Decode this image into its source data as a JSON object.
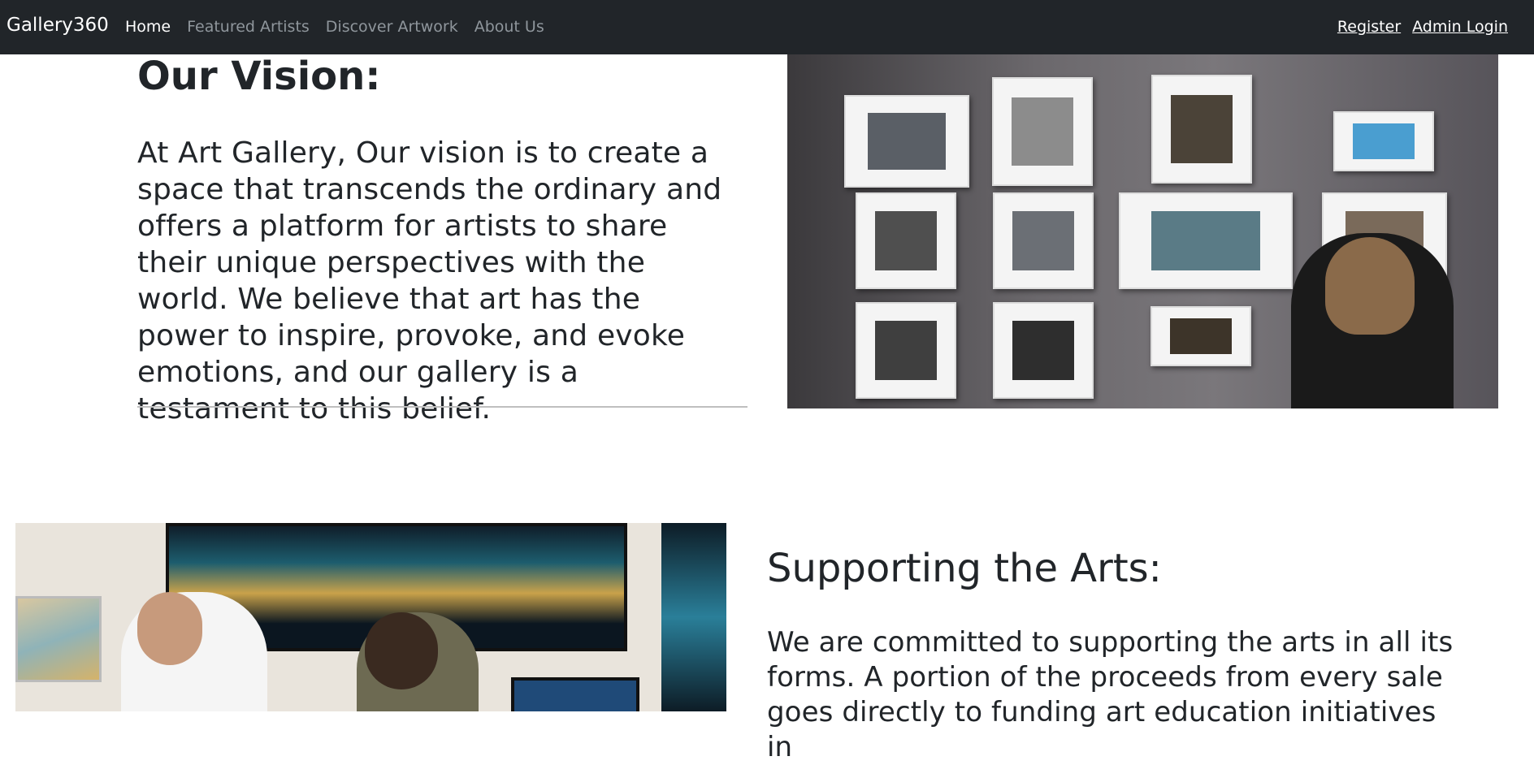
{
  "navbar": {
    "brand": "Gallery360",
    "links": [
      {
        "label": "Home",
        "active": true
      },
      {
        "label": "Featured Artists",
        "active": false
      },
      {
        "label": "Discover Artwork",
        "active": false
      },
      {
        "label": "About Us",
        "active": false
      }
    ],
    "register": "Register",
    "admin_login": "Admin Login"
  },
  "vision": {
    "title": "Our Vision:",
    "text": "At Art Gallery, Our vision is to create a space that transcends the ordinary and offers a platform for artists to share their unique perspectives with the world. We believe that art has the power to inspire, provoke, and evoke emotions, and our gallery is a testament to this belief."
  },
  "supporting": {
    "title": "Supporting the Arts:",
    "text": "We are committed to supporting the arts in all its forms. A portion of the proceeds from every sale goes directly to funding art education initiatives in"
  },
  "colors": {
    "navbar_bg": "#212529",
    "nav_link_muted": "#8f969c",
    "text": "#212529"
  }
}
